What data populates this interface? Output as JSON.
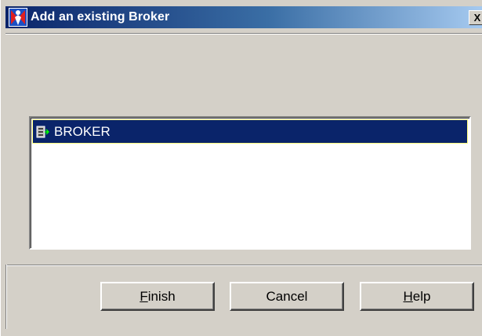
{
  "window": {
    "title": "Add an existing Broker",
    "close_label": "X"
  },
  "broker_list": {
    "items": [
      {
        "label": "BROKER",
        "selected": true,
        "icon": "broker-icon"
      }
    ]
  },
  "buttons": {
    "finish_mnemonic": "F",
    "finish_rest": "inish",
    "cancel_label": "Cancel",
    "help_mnemonic": "H",
    "help_rest": "elp"
  },
  "colors": {
    "titlebar_start": "#0a246a",
    "titlebar_end": "#a6caf0",
    "selection": "#0a246a",
    "face": "#d4d0c8"
  }
}
